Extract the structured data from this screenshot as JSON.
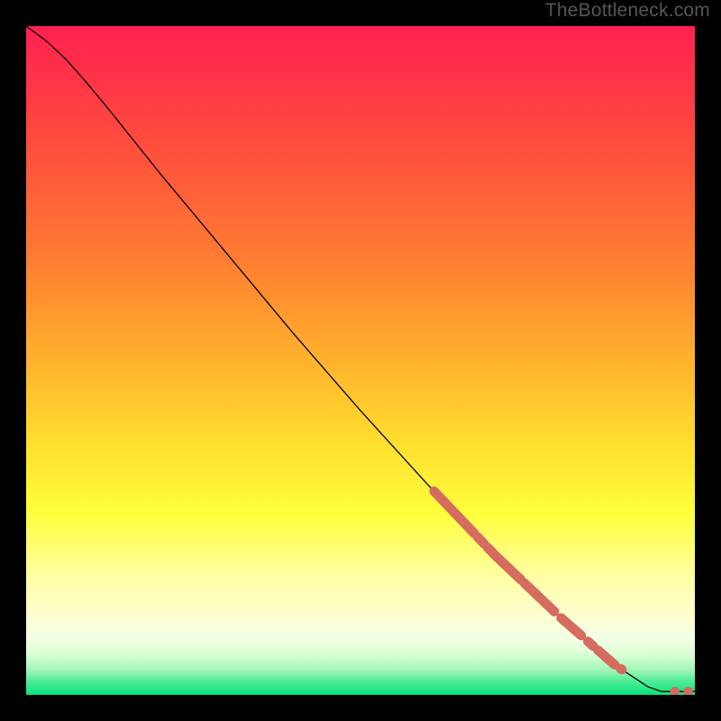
{
  "watermark": "TheBottleneck.com",
  "chart_data": {
    "type": "line",
    "title": "",
    "xlabel": "",
    "ylabel": "",
    "xlim": [
      0,
      100
    ],
    "ylim": [
      0,
      100
    ],
    "background": {
      "type": "vertical_heat_gradient",
      "stops": [
        {
          "pos": 0.0,
          "color": "#ff2051"
        },
        {
          "pos": 0.17,
          "color": "#ff4b3e"
        },
        {
          "pos": 0.34,
          "color": "#ff7a32"
        },
        {
          "pos": 0.5,
          "color": "#ffb22d"
        },
        {
          "pos": 0.63,
          "color": "#ffe02f"
        },
        {
          "pos": 0.73,
          "color": "#ffff3d"
        },
        {
          "pos": 0.82,
          "color": "#ffffa0"
        },
        {
          "pos": 0.88,
          "color": "#fdffd0"
        },
        {
          "pos": 0.915,
          "color": "#f4ffe6"
        },
        {
          "pos": 0.94,
          "color": "#d9ffd4"
        },
        {
          "pos": 0.962,
          "color": "#a3f7b8"
        },
        {
          "pos": 0.98,
          "color": "#4eec96"
        },
        {
          "pos": 1.0,
          "color": "#07e27b"
        }
      ]
    },
    "series": [
      {
        "name": "curve",
        "type": "line",
        "color": "#000000",
        "width": 1.3,
        "points": [
          {
            "x": 0.0,
            "y": 100.0
          },
          {
            "x": 3.0,
            "y": 97.8
          },
          {
            "x": 6.0,
            "y": 95.0
          },
          {
            "x": 9.0,
            "y": 91.6
          },
          {
            "x": 12.0,
            "y": 88.0
          },
          {
            "x": 20.0,
            "y": 78.0
          },
          {
            "x": 30.0,
            "y": 66.0
          },
          {
            "x": 40.0,
            "y": 54.0
          },
          {
            "x": 50.0,
            "y": 42.5
          },
          {
            "x": 60.0,
            "y": 31.5
          },
          {
            "x": 70.0,
            "y": 21.0
          },
          {
            "x": 80.0,
            "y": 11.5
          },
          {
            "x": 88.0,
            "y": 4.5
          },
          {
            "x": 93.0,
            "y": 1.2
          },
          {
            "x": 95.0,
            "y": 0.5
          },
          {
            "x": 100.0,
            "y": 0.5
          }
        ]
      },
      {
        "name": "highlight_segments_on_curve",
        "type": "scatter_segments",
        "color": "#d66b60",
        "radius": 5.3,
        "segments": [
          {
            "x_start": 61,
            "x_end": 67
          },
          {
            "x_start": 67.5,
            "x_end": 68.5
          },
          {
            "x_start": 69,
            "x_end": 74
          },
          {
            "x_start": 74.5,
            "x_end": 79
          },
          {
            "x_start": 80,
            "x_end": 83
          },
          {
            "x_start": 84,
            "x_end": 84.8
          },
          {
            "x_start": 85.5,
            "x_end": 88
          },
          {
            "x_start": 88.9,
            "x_end": 89.1
          }
        ]
      },
      {
        "name": "flat_tail_points",
        "type": "scatter",
        "color": "#d66b60",
        "radius": 5.3,
        "points": [
          {
            "x": 97.0,
            "y": 0.5
          },
          {
            "x": 99.0,
            "y": 0.5
          }
        ]
      }
    ]
  }
}
